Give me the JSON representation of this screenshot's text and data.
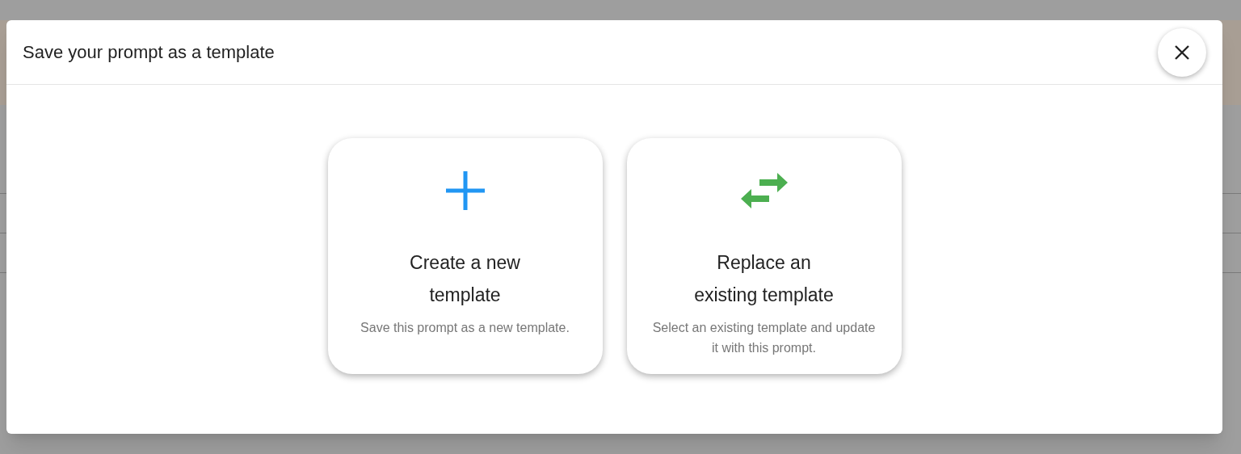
{
  "dialog": {
    "title": "Save your prompt as a template"
  },
  "options": [
    {
      "kind": "add",
      "title": "Create a new template",
      "description": "Save this prompt as a new template."
    },
    {
      "kind": "swap",
      "title": "Replace an existing template",
      "description": "Select an existing template and update it with this prompt."
    }
  ]
}
